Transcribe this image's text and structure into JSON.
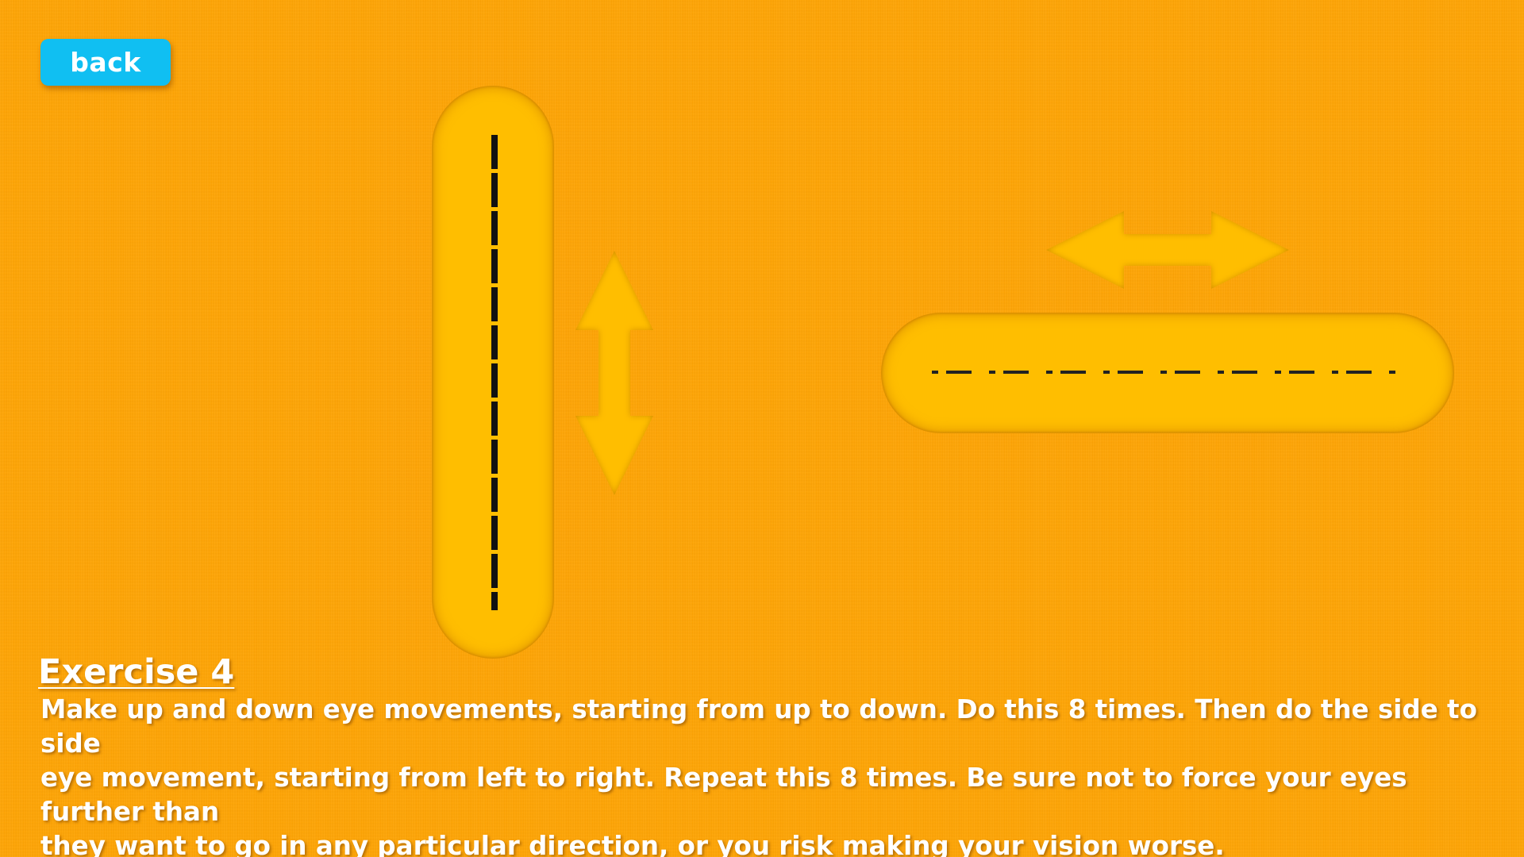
{
  "navigation": {
    "back_label": "back"
  },
  "exercise": {
    "title": "Exercise 4",
    "description_lines": [
      "Make up and down eye movements, starting from up to down. Do this 8 times. Then do the side to side",
      "eye movement, starting from left to right. Repeat this 8 times. Be sure not to force your eyes further than",
      "they want to go in any particular direction, or you risk making your vision worse."
    ]
  },
  "icons": {
    "vertical_arrow": "up-down-arrow-icon",
    "horizontal_arrow": "left-right-arrow-icon"
  },
  "colors": {
    "background": "#ffa505",
    "track": "#ffbe00",
    "button": "#10bff2",
    "text": "#ffffff",
    "dash": "#111111"
  }
}
